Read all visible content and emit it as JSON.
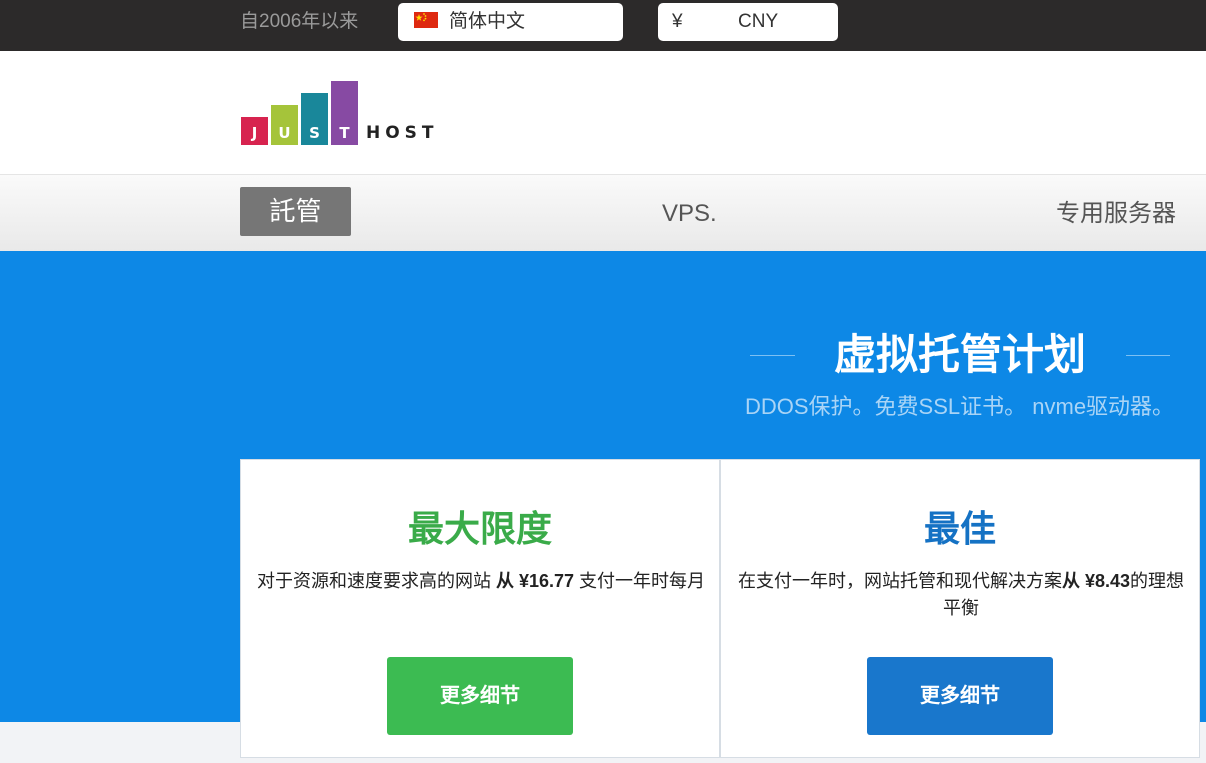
{
  "topbar": {
    "since": "自2006年以来",
    "language": {
      "label": "简体中文",
      "flag": "china-flag-icon"
    },
    "currency": {
      "symbol": "¥",
      "code": "CNY"
    }
  },
  "logo": {
    "letters": [
      "J",
      "U",
      "S",
      "T"
    ],
    "suffix": "HOST",
    "colors": [
      "#d7234f",
      "#a5c43a",
      "#19879a",
      "#874aa3"
    ]
  },
  "nav": {
    "hosting": "託管",
    "vps": "VPS.",
    "dedicated": "专用服务器"
  },
  "hero": {
    "title": "虚拟托管计划",
    "subtitle": "DDOS保护。免费SSL证书。 nvme驱动器。"
  },
  "plans": [
    {
      "title": "最大限度",
      "desc_pre": "对于资源和速度要求高的网站 ",
      "desc_price": "从 ¥16.77",
      "desc_post": " 支付一年时每月",
      "button": "更多细节",
      "color": "#3aab49"
    },
    {
      "title": "最佳",
      "desc_pre": "在支付一年时，网站托管和现代解决方案",
      "desc_price": "从 ¥8.43",
      "desc_post": "的理想平衡",
      "button": "更多细节",
      "color": "#1572c4"
    }
  ],
  "colors": {
    "topbar_bg": "#2c2a2a",
    "hero_bg": "#0d88e6",
    "green_button": "#3cbb52",
    "blue_button": "#1977cc"
  }
}
